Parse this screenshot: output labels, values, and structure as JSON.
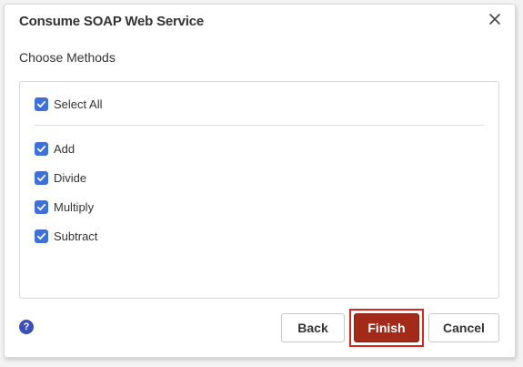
{
  "dialog": {
    "title": "Consume SOAP Web Service",
    "subtitle": "Choose Methods"
  },
  "methods": {
    "select_all": {
      "label": "Select All",
      "checked": true
    },
    "items": [
      {
        "label": "Add",
        "checked": true
      },
      {
        "label": "Divide",
        "checked": true
      },
      {
        "label": "Multiply",
        "checked": true
      },
      {
        "label": "Subtract",
        "checked": true
      }
    ]
  },
  "footer": {
    "help_glyph": "?",
    "back_label": "Back",
    "finish_label": "Finish",
    "cancel_label": "Cancel"
  },
  "colors": {
    "checkbox": "#3f6fd8",
    "finish": "#a32a18",
    "focus_outline": "#d5271f",
    "help": "#3a4fb8"
  }
}
